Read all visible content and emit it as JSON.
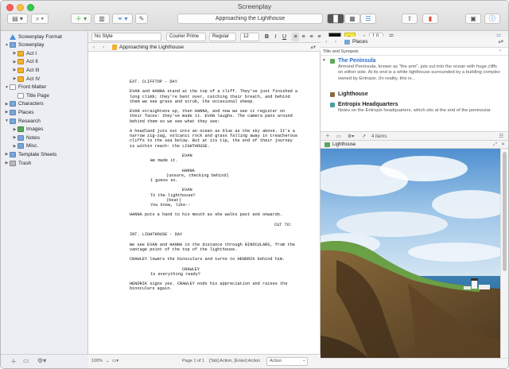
{
  "window": {
    "title": "Screenplay"
  },
  "toolbar": {
    "document_title": "Approaching the Lighthouse",
    "view_icons": [
      "binder-icon",
      "search-icon",
      "add-icon",
      "trash-icon",
      "link-icon",
      "compose-icon",
      "split-icon",
      "outliner-icon",
      "share-icon",
      "bookmark-icon",
      "inspector-icon",
      "info-icon"
    ]
  },
  "format_bar": {
    "style": "No Style",
    "font": "Courier Prime",
    "weight": "Regular",
    "size": "12",
    "bold": "B",
    "italic": "I",
    "underline": "U",
    "spacing": "1.0"
  },
  "binder": {
    "items": [
      {
        "label": "Screenplay Format",
        "level": 0,
        "icon": "format-icon",
        "expand": ""
      },
      {
        "label": "Screenplay",
        "level": 0,
        "icon": "folder-icon",
        "expand": "▼"
      },
      {
        "label": "Act I",
        "level": 1,
        "icon": "act-icon",
        "expand": "▶"
      },
      {
        "label": "Act II",
        "level": 1,
        "icon": "act-icon",
        "expand": "▶"
      },
      {
        "label": "Act III",
        "level": 1,
        "icon": "act-icon",
        "expand": "▶"
      },
      {
        "label": "Act IV",
        "level": 1,
        "icon": "act-icon",
        "expand": "▶"
      },
      {
        "label": "Front Matter",
        "level": 0,
        "icon": "doc-icon",
        "expand": "▼"
      },
      {
        "label": "Title Page",
        "level": 1,
        "icon": "doc-icon",
        "expand": ""
      },
      {
        "label": "Characters",
        "level": 0,
        "icon": "folder-icon",
        "expand": "▶"
      },
      {
        "label": "Places",
        "level": 0,
        "icon": "folder-icon",
        "expand": "▶"
      },
      {
        "label": "Research",
        "level": 0,
        "icon": "folder-icon",
        "expand": "▼"
      },
      {
        "label": "Images",
        "level": 1,
        "icon": "image-icon",
        "expand": "▶"
      },
      {
        "label": "Notes",
        "level": 1,
        "icon": "folder-icon",
        "expand": "▶"
      },
      {
        "label": "Misc.",
        "level": 1,
        "icon": "folder-icon",
        "expand": "▶"
      },
      {
        "label": "Template Sheets",
        "level": 0,
        "icon": "folder-icon",
        "expand": "▶"
      },
      {
        "label": "Trash",
        "level": 0,
        "icon": "trash-icon",
        "expand": "▶"
      }
    ]
  },
  "editor": {
    "header_title": "Approaching the Lighthouse",
    "script": [
      {
        "type": "scene",
        "text": "EXT. CLIFFTOP - DAY"
      },
      {
        "type": "action",
        "text": "EVAN and HANNA stand at the top of a cliff. They've just finished a long climb; they're bent over, catching their breath, and behind them we see grass and scrub, the occasional sheep."
      },
      {
        "type": "action",
        "text": "EVAN straightens up, then HANNA, and now we see it register on their faces: they've made it. EVAN laughs. The camera pans around behind them so we see what they see:"
      },
      {
        "type": "action",
        "text": "A headland juts out into an ocean as blue as the sky above. It's a narrow zig-zag, volcanic rock and grass falling away in treacherous cliffs to the sea below. But at its tip, the end of their journey is within reach: the LIGHTHOUSE."
      },
      {
        "type": "character",
        "text": "EVAN"
      },
      {
        "type": "dialogue",
        "text": "We made it."
      },
      {
        "type": "character",
        "text": "HANNA"
      },
      {
        "type": "parenthetical",
        "text": "(unsure, checking behind)"
      },
      {
        "type": "dialogue",
        "text": "I guess so."
      },
      {
        "type": "character",
        "text": "EVAN"
      },
      {
        "type": "dialogue_nb",
        "text": "To the lighthouse?"
      },
      {
        "type": "parenthetical",
        "text": "(beat)"
      },
      {
        "type": "dialogue",
        "text": "You know, like--"
      },
      {
        "type": "action",
        "text": "HANNA puts a hand to his mouth as she walks past and onwards."
      },
      {
        "type": "transition",
        "text": "CUT TO:"
      },
      {
        "type": "scene",
        "text": "INT. LIGHTHOUSE - DAY"
      },
      {
        "type": "action",
        "text": "We see EVAN and HANNA in the distance through BINOCULARS, from the vantage point of the top of the lighthouse."
      },
      {
        "type": "action",
        "text": "CRAWLEY lowers the binoculars and turns to HENDRIK behind him."
      },
      {
        "type": "character",
        "text": "CRAWLEY"
      },
      {
        "type": "dialogue",
        "text": "Is everything ready?"
      },
      {
        "type": "action",
        "text": "HENDRIK signs yes. CRAWLEY nods his appreciation and raises the binoculars again."
      }
    ],
    "footer": {
      "zoom": "100%",
      "page": "Page 1 of 1",
      "hint": "[Tab] Action, [Enter] Action",
      "element": "Action"
    }
  },
  "inspector": {
    "header_title": "Places",
    "section_label": "Title and Synopsis",
    "places": [
      {
        "title": "The Peninsula",
        "synopsis": "Armond Peninsula, known as \"the arm\", juts out into the ocean with huge cliffs on either side. At its end is a white lighthouse surrounded by a building complex owned by Entropix. (In reality, this is...",
        "expand": "▼",
        "color": "#2f6fc9"
      },
      {
        "title": "Lighthouse",
        "synopsis": "",
        "expand": "",
        "color": "#222222"
      },
      {
        "title": "Entropix Headquarters",
        "synopsis": "Notes on the Entropix headquarters, which sits at the end of the peninsular.",
        "expand": "",
        "color": "#222222"
      }
    ],
    "items_count": "4 items",
    "image_header": "Lighthouse"
  }
}
